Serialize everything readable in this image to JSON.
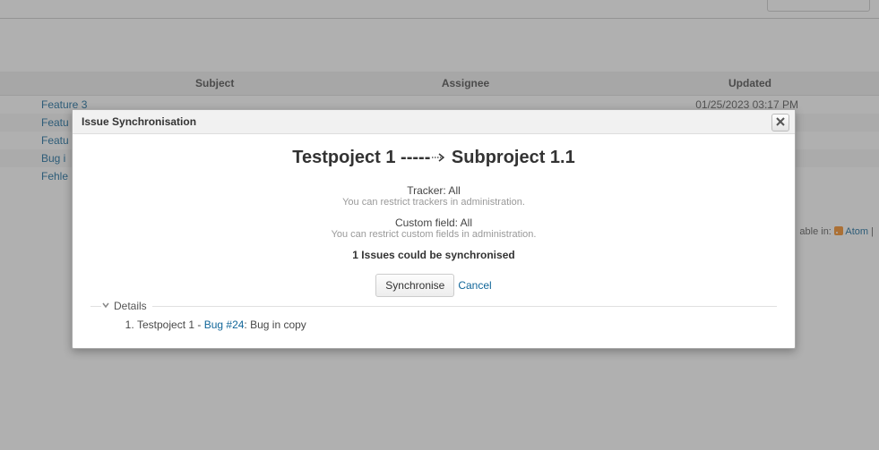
{
  "table": {
    "headers": {
      "subject": "Subject",
      "assignee": "Assignee",
      "updated": "Updated"
    },
    "rows": [
      {
        "subject": "Feature 3",
        "updated": "01/25/2023 03:17 PM"
      },
      {
        "subject": "Featu",
        "updated": ""
      },
      {
        "subject": "Featu",
        "updated": ""
      },
      {
        "subject": "Bug i",
        "updated": ""
      },
      {
        "subject": "Fehle",
        "updated": ""
      }
    ]
  },
  "also_available": {
    "label": "able in:",
    "atom": "Atom",
    "sep": "|"
  },
  "dialog": {
    "title": "Issue Synchronisation",
    "heading_from": "Testpoject 1",
    "heading_dashes": "-----",
    "heading_to": "Subproject 1.1",
    "tracker_line": "Tracker: All",
    "tracker_sub": "You can restrict trackers in administration.",
    "cf_line": "Custom field: All",
    "cf_sub": "You can restrict custom fields in administration.",
    "count_line": "1 Issues could be synchronised",
    "sync_btn": "Synchronise",
    "cancel": "Cancel",
    "details_label": "Details",
    "detail_item_prefix": "Testpoject 1 - ",
    "detail_item_link": "Bug #24",
    "detail_item_suffix": ": Bug in copy"
  }
}
